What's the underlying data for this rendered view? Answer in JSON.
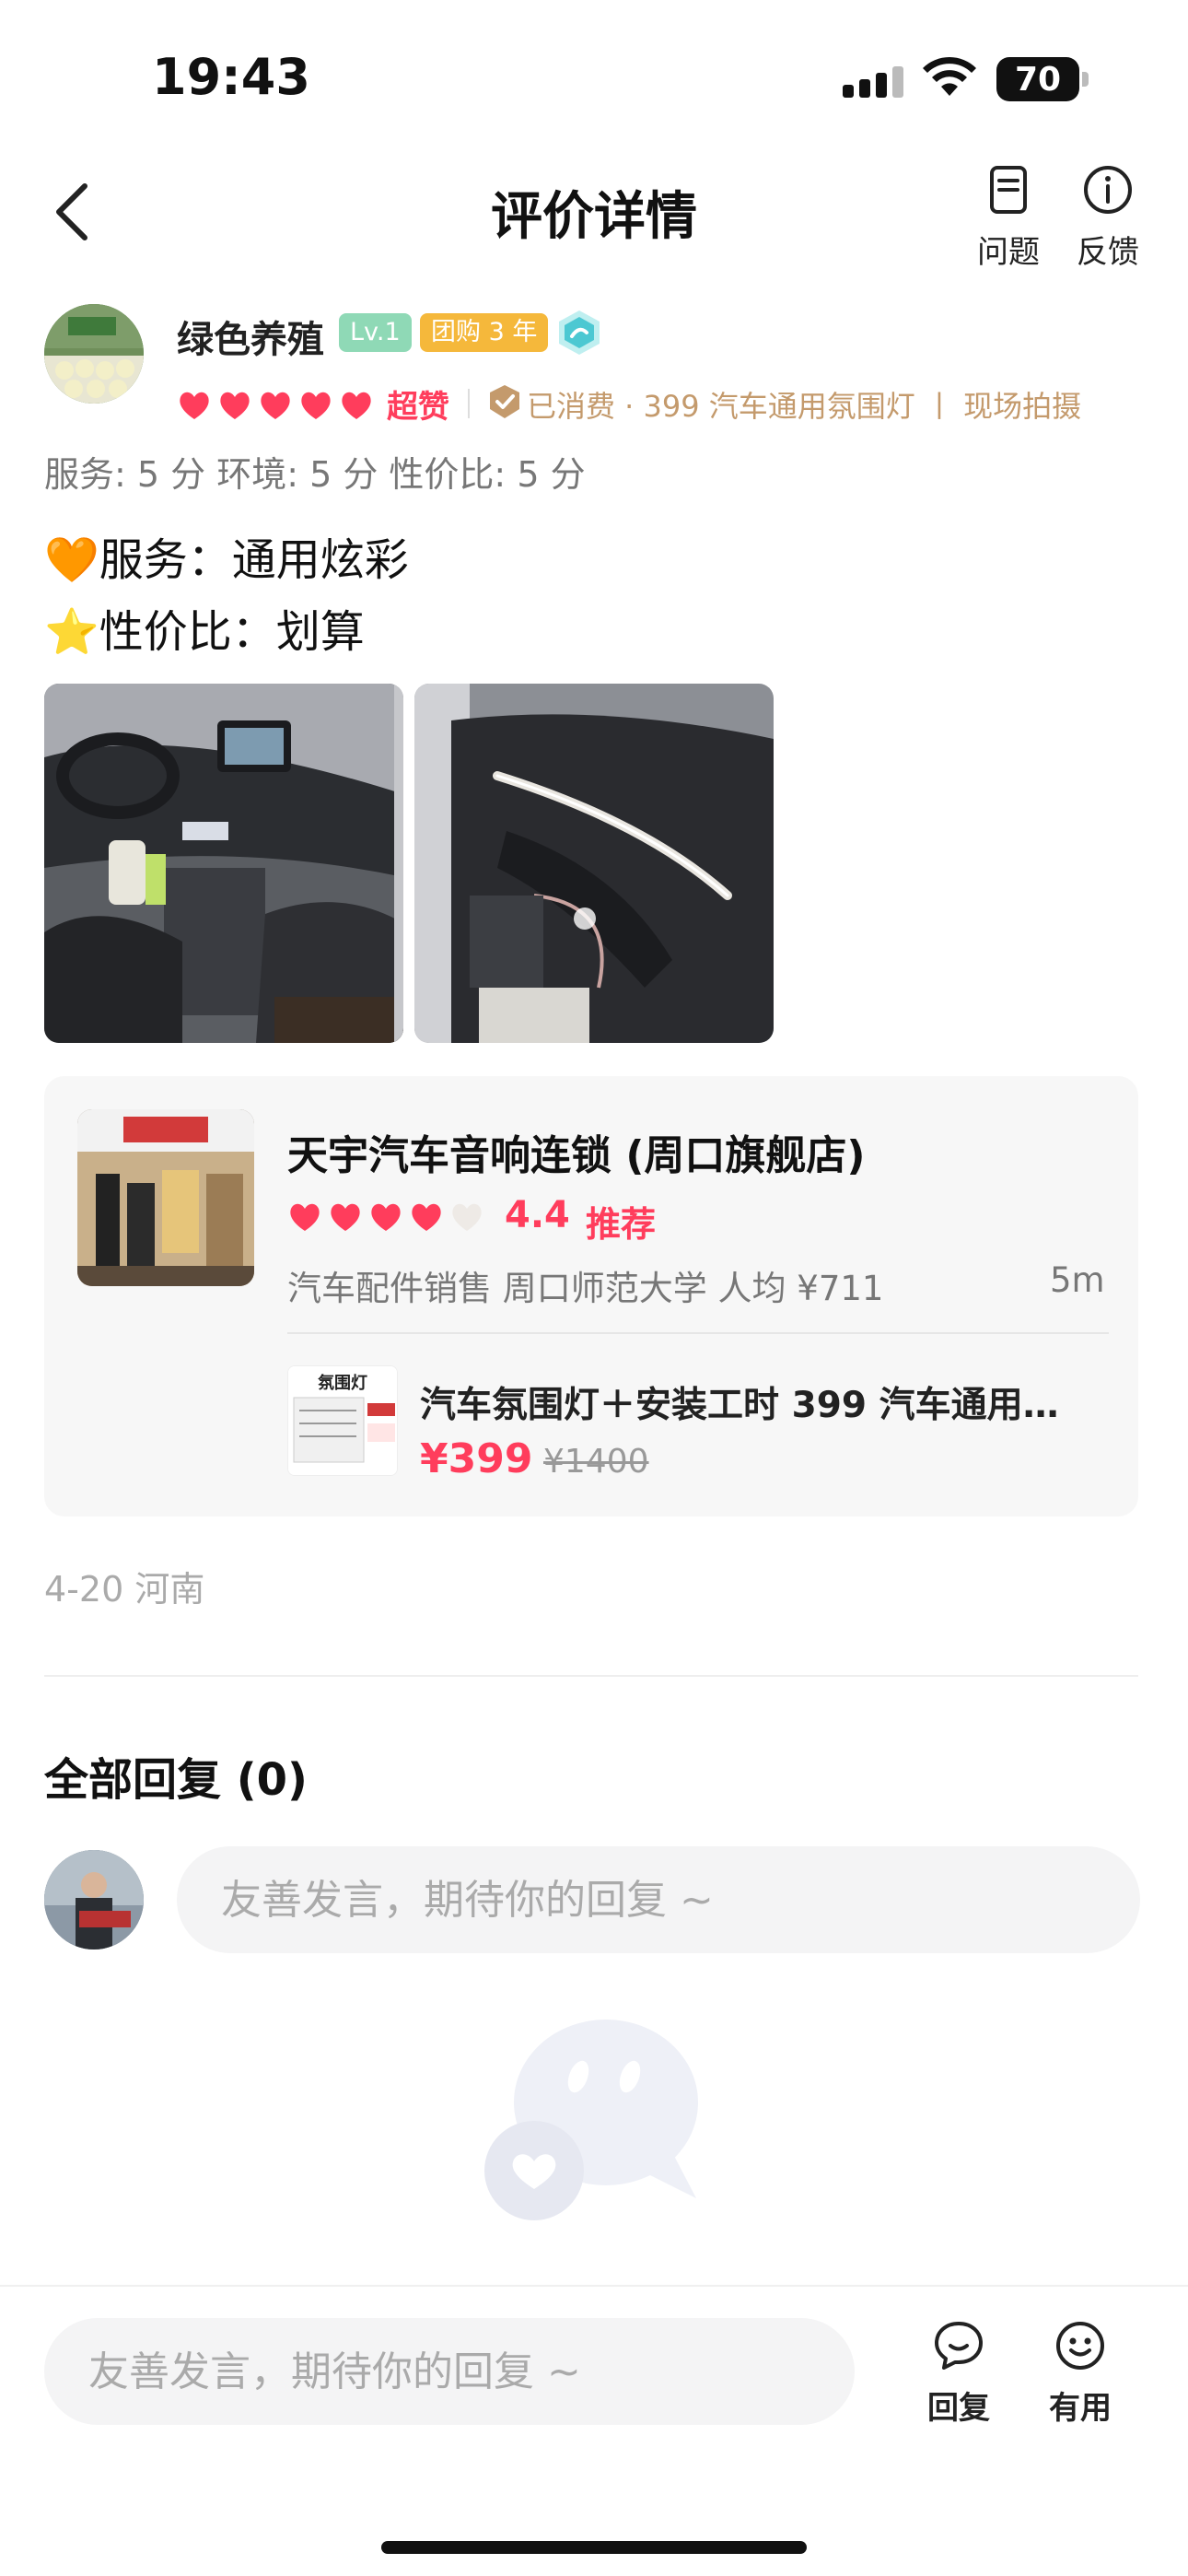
{
  "status_bar": {
    "time": "19:43",
    "battery": "70"
  },
  "nav": {
    "title": "评价详情",
    "question_label": "问题",
    "feedback_label": "反馈"
  },
  "review": {
    "user_name": "绿色养殖",
    "level_badge": "Lv.1",
    "group_badge": "团购 3 年",
    "rating_hearts": 5,
    "rating_label": "超赞",
    "consumption": "已消费 · 399 汽车通用氛围灯 丨 现场拍摄",
    "scores": "服务: 5 分  环境: 5 分  性价比: 5 分",
    "line1_emoji": "🧡",
    "line1": "服务：通用炫彩",
    "line2_emoji": "⭐",
    "line2": "性价比：划算",
    "photos": [
      "car-interior-photo",
      "car-door-photo"
    ]
  },
  "shop": {
    "name": "天宇汽车音响连锁 (周口旗舰店)",
    "hearts": 4,
    "rating": "4.4",
    "recommend": "推荐",
    "info": "汽车配件销售   周口师范大学   人均 ¥711",
    "distance": "5m",
    "deal_title": "汽车氛围灯＋安装工时 399 汽车通用…",
    "deal_price": "¥399",
    "deal_original": "¥1400",
    "deal_image_text": "氛围灯"
  },
  "meta": "4-20  河南",
  "replies": {
    "title": "全部回复 (0)",
    "placeholder": "友善发言，期待你的回复 ~"
  },
  "bottom_bar": {
    "placeholder": "友善发言，期待你的回复 ~",
    "reply_label": "回复",
    "useful_label": "有用"
  },
  "colors": {
    "accent_red": "#ff3d5c",
    "consumed_gold": "#c49a6c",
    "level_green": "#8fd9b6",
    "group_orange": "#f5b83b"
  }
}
